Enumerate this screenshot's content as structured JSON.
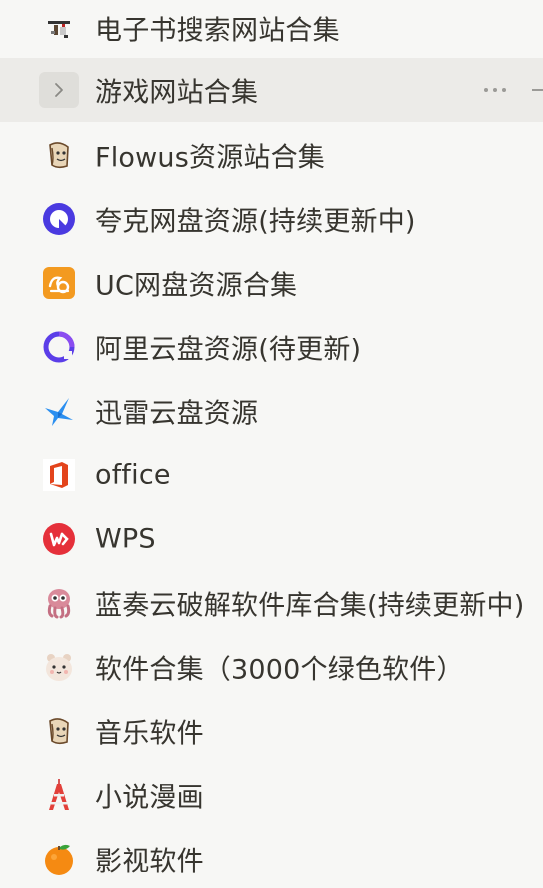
{
  "items": [
    {
      "label": "电子书搜索网站合集",
      "icon": "pixel-art-icon"
    },
    {
      "label": "游戏网站合集",
      "icon": "chevron-right-icon"
    },
    {
      "label": "Flowus资源站合集",
      "icon": "cartoon-face-icon"
    },
    {
      "label": "夸克网盘资源(持续更新中)",
      "icon": "quark-icon"
    },
    {
      "label": "UC网盘资源合集",
      "icon": "uc-browser-icon"
    },
    {
      "label": "阿里云盘资源(待更新)",
      "icon": "aliyun-drive-icon"
    },
    {
      "label": "迅雷云盘资源",
      "icon": "xunlei-bird-icon"
    },
    {
      "label": "office",
      "icon": "office-icon"
    },
    {
      "label": "WPS",
      "icon": "wps-icon"
    },
    {
      "label": "蓝奏云破解软件库合集(持续更新中)",
      "icon": "octopus-icon"
    },
    {
      "label": "软件合集（3000个绿色软件）",
      "icon": "hamster-icon"
    },
    {
      "label": "音乐软件",
      "icon": "cartoon-face-icon"
    },
    {
      "label": "小说漫画",
      "icon": "tokyo-tower-icon"
    },
    {
      "label": "影视软件",
      "icon": "tangerine-icon"
    }
  ],
  "hovered_index": 1,
  "colors": {
    "text": "#37352f",
    "background": "#f7f7f5",
    "hover": "#ecebe8"
  }
}
